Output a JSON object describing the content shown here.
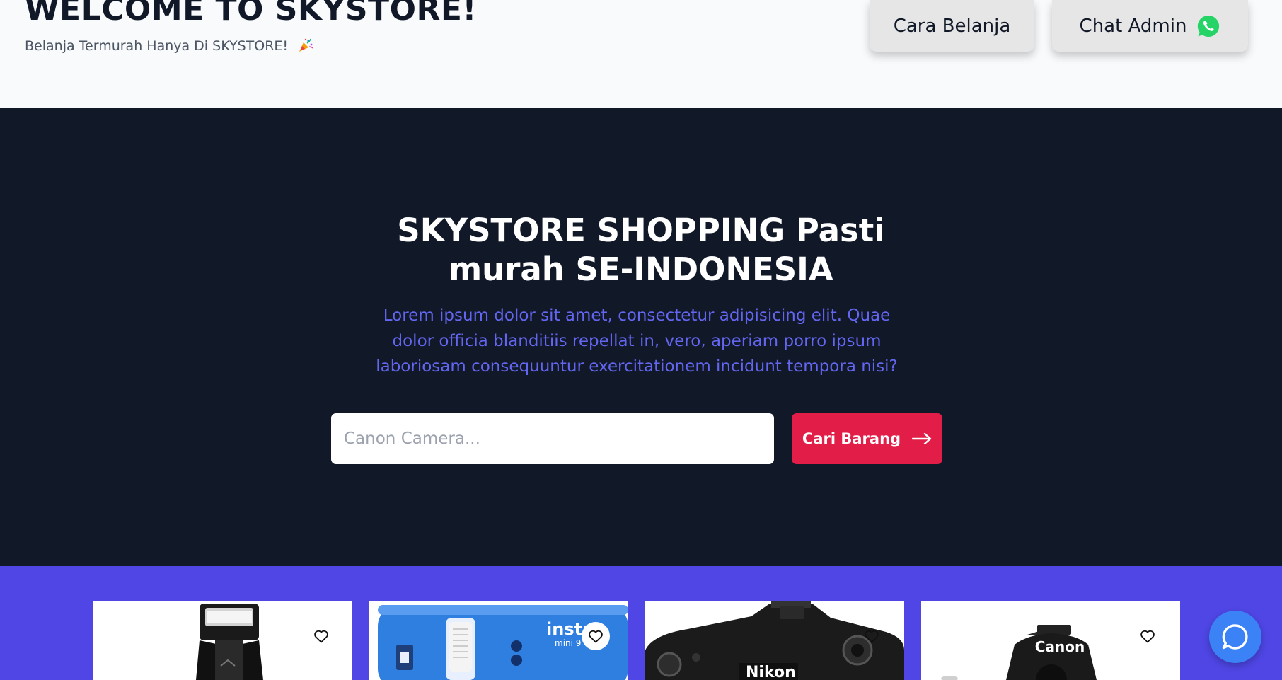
{
  "header": {
    "title": "WELCOME TO SKYSTORE!",
    "tagline": "Belanja Termurah Hanya Di SKYSTORE!",
    "tagline_icon": "party-popper-icon",
    "cara_belanja_label": "Cara Belanja",
    "chat_admin_label": "Chat Admin",
    "chat_admin_icon": "whatsapp-icon"
  },
  "hero": {
    "title": "SKYSTORE SHOPPING Pasti murah SE-INDONESIA",
    "description": "Lorem ipsum dolor sit amet, consectetur adipisicing elit. Quae dolor officia blanditiis repellat in, vero, aperiam porro ipsum laboriosam consequuntur exercitationem incidunt tempora nisi?",
    "search_placeholder": "Canon Camera...",
    "search_value": "",
    "search_button_label": "Cari Barang",
    "search_button_icon": "arrow-right-icon"
  },
  "products": {
    "items": [
      {
        "image": "camera-flash-image",
        "brand": "",
        "icon": "heart-icon"
      },
      {
        "image": "instax-mini-9-camera-image",
        "brand": "instax",
        "model": "mini 9",
        "icon": "heart-icon"
      },
      {
        "image": "nikon-dslr-camera-image",
        "brand": "Nikon",
        "icon": "heart-icon"
      },
      {
        "image": "canon-dslr-camera-image",
        "brand": "Canon",
        "icon": "heart-icon"
      }
    ]
  },
  "chat_widget": {
    "icon": "chat-bubble-icon"
  },
  "colors": {
    "hero_bg": "#111827",
    "accent_text": "#6366f1",
    "search_button": "#e11d48",
    "products_bg": "#4f46e5",
    "chat_fab": "#3b82f6",
    "whatsapp": "#25d366"
  }
}
